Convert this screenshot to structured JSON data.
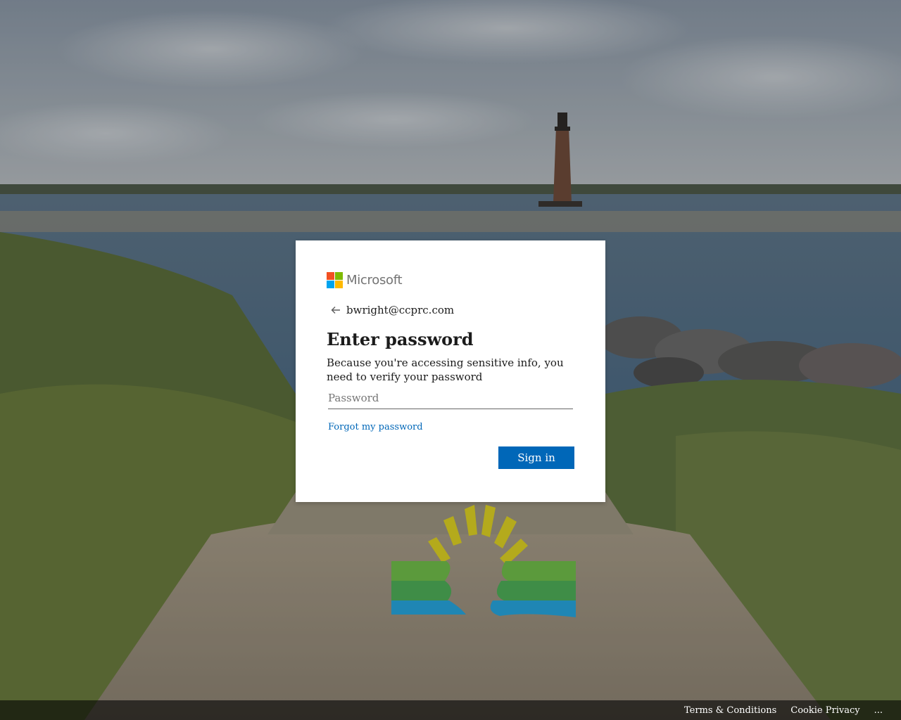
{
  "brand": {
    "wordmark": "Microsoft",
    "logo_colors": [
      "#f25022",
      "#7fba00",
      "#00a4ef",
      "#ffb900"
    ]
  },
  "identity": {
    "back_icon": "arrow-left-icon",
    "email": "bwright@ccprc.com"
  },
  "form": {
    "title": "Enter password",
    "description": "Because you're accessing sensitive info, you need to verify your password",
    "password_placeholder": "Password",
    "password_value": "",
    "forgot_link": "Forgot my password",
    "submit_label": "Sign in"
  },
  "footer": {
    "links": [
      "Terms & Conditions",
      "Cookie Privacy",
      "..."
    ]
  },
  "colors": {
    "accent": "#0067b8",
    "link": "#0067b8",
    "text": "#1b1b1b"
  }
}
